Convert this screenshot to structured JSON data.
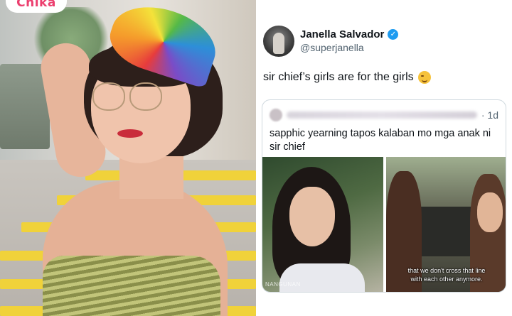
{
  "brand": {
    "logo_text": "Chika",
    "accent_color": "#ec3f6f"
  },
  "tweet": {
    "author_name": "Janella Salvador",
    "author_handle": "@superjanella",
    "verified_icon": "verified-badge-icon",
    "text": "sir chief’s girls are for the girls",
    "emoji": "smirking-face-emoji",
    "quote": {
      "time": "· 1d",
      "text": "sapphic yearning tapos kalaban mo mga anak ni sir chief",
      "images": [
        {
          "watermark": "NANGUNAN"
        },
        {
          "subtitle_line1": "that we don't cross that line",
          "subtitle_line2": "with each other anymore."
        }
      ]
    }
  }
}
